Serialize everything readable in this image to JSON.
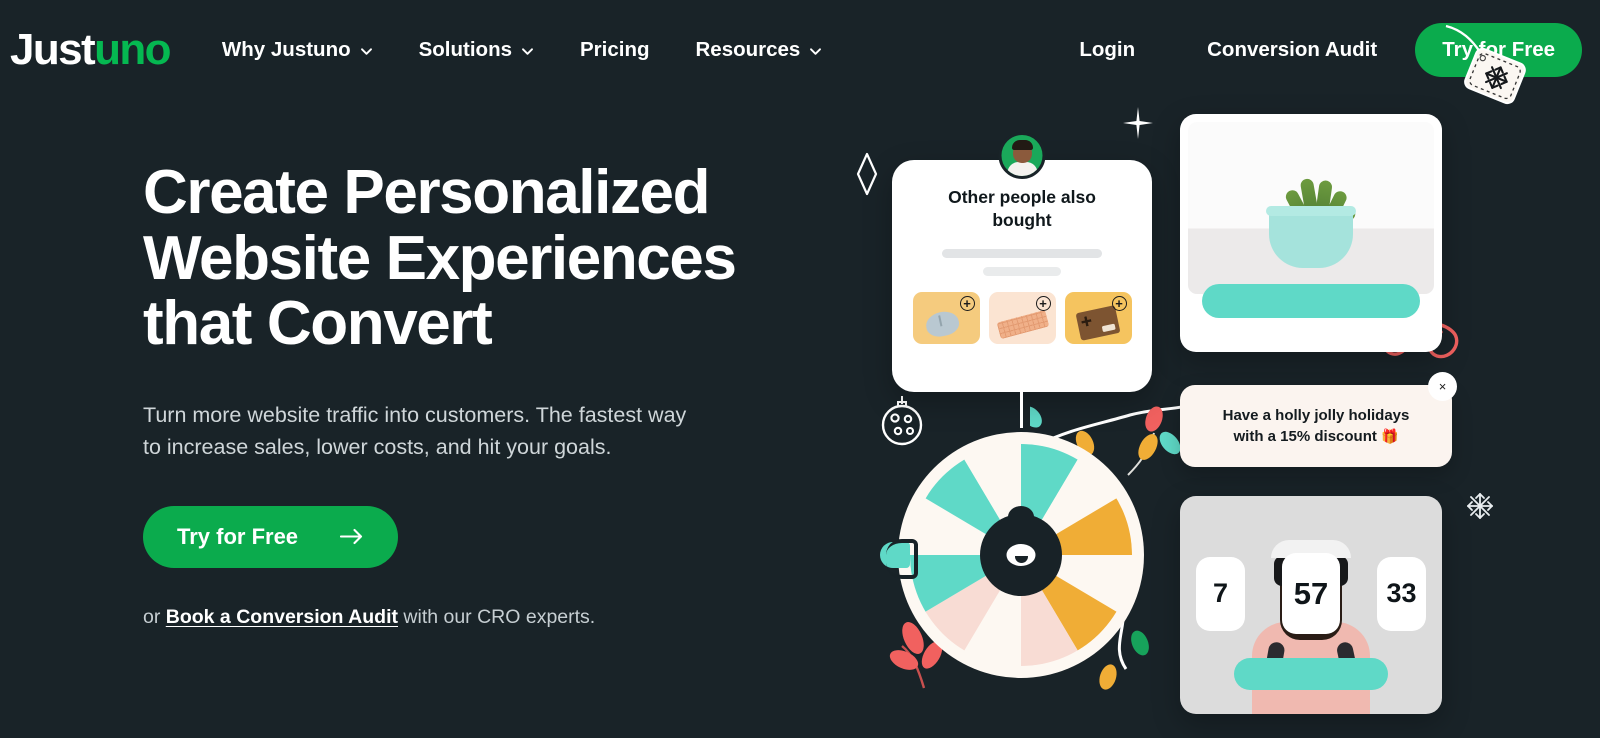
{
  "brand": {
    "logo_primary": "Just",
    "logo_accent": "uno",
    "accent_green": "#0bab4d",
    "background": "#192328",
    "teal": "#5fd9c7",
    "amber": "#f0ad36",
    "pink": "#f8dcd4",
    "cream": "#fdf8f2",
    "red": "#f1615f"
  },
  "header": {
    "nav": [
      {
        "label": "Why Justuno",
        "has_dropdown": true,
        "icon": "chevron-down-icon"
      },
      {
        "label": "Solutions",
        "has_dropdown": true,
        "icon": "chevron-down-icon"
      },
      {
        "label": "Pricing",
        "has_dropdown": false,
        "icon": ""
      },
      {
        "label": "Resources",
        "has_dropdown": true,
        "icon": "chevron-down-icon"
      }
    ],
    "login_label": "Login",
    "audit_label": "Conversion Audit",
    "cta_label": "Try for Free"
  },
  "hero": {
    "title_line1": "Create Personalized",
    "title_line2": "Website Experiences",
    "title_line3": "that Convert",
    "subtitle": "Turn more website traffic into customers. The fastest way to increase sales, lower costs, and hit your goals.",
    "cta_label": "Try for Free",
    "cta_icon": "arrow-right-icon",
    "note_prefix": "or ",
    "note_link": "Book a Conversion Audit",
    "note_suffix": " with our CRO experts."
  },
  "art": {
    "recommendation_card": {
      "title": "Other people also bought",
      "avatar_icon": "user-avatar",
      "products": [
        {
          "name": "computer-mouse-thumbnail",
          "add_icon": "plus-circle-icon",
          "add_label": "+"
        },
        {
          "name": "keyboard-thumbnail",
          "add_icon": "plus-circle-icon",
          "add_label": "+"
        },
        {
          "name": "game-controller-thumbnail",
          "add_icon": "plus-circle-icon",
          "add_label": "+"
        }
      ]
    },
    "plant_card": {
      "image_alt": "succulent-plant-photo",
      "cta_bar": "teal-button-placeholder"
    },
    "holiday_card": {
      "line1": "Have a holly jolly holidays",
      "line2": "with a 15% discount",
      "emoji": "🎁",
      "close_icon": "close-icon",
      "close_label": "×"
    },
    "countdown_card": {
      "image_alt": "vr-headset-person-photo",
      "values": [
        "7",
        "57",
        "33"
      ],
      "cta_bar": "teal-button-placeholder"
    },
    "spin_wheel": {
      "name": "spin-to-win-wheel",
      "segment_count": 12
    },
    "decorations": [
      "sparkle-star-icon",
      "diamond-outline-icon",
      "ornament-ball-icon",
      "gift-tag-snowflake-icon",
      "snowflake-icon",
      "ribbon-swirl-icon",
      "holiday-lights-string",
      "red-leaf-sprig",
      "autumn-leaf"
    ]
  }
}
